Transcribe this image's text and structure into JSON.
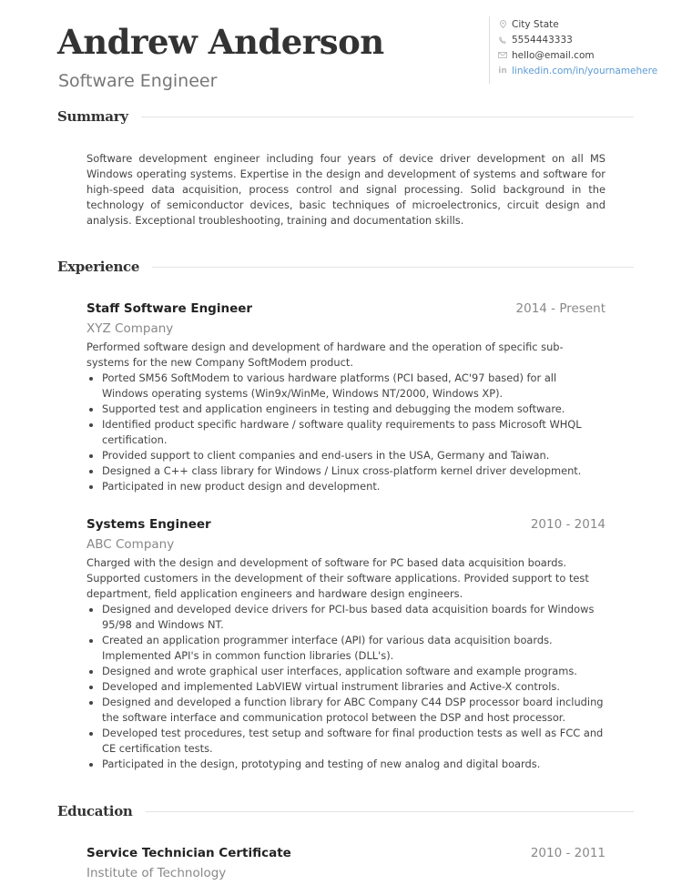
{
  "header": {
    "name": "Andrew Anderson",
    "title": "Software Engineer"
  },
  "contact": {
    "location": {
      "icon": "location-pin-icon",
      "value": "City State"
    },
    "phone": {
      "icon": "phone-icon",
      "value": "5554443333"
    },
    "email": {
      "icon": "envelope-icon",
      "value": "hello@email.com"
    },
    "linkedin": {
      "icon": "linkedin-icon",
      "value": "linkedin.com/in/yournamehere"
    },
    "link_color": "#5b9bd5"
  },
  "sections": {
    "summary": "Summary",
    "experience": "Experience",
    "education": "Education"
  },
  "summary": "Software development engineer including four years of device driver development on all MS Windows operating systems.  Expertise in the design and development of systems and software for high-speed data acquisition, process control and signal processing.  Solid background in the technology of semiconductor devices, basic techniques of microelectronics, circuit design and analysis.  Exceptional troubleshooting, training and documentation skills.",
  "experience": [
    {
      "title": "Staff Software Engineer",
      "dates": "2014 - Present",
      "company": "XYZ Company",
      "description": "Performed software design and development of hardware and the operation of specific sub-systems for the new Company SoftModem product.",
      "bullets": [
        "Ported SM56 SoftModem to various hardware platforms (PCI based, AC'97 based) for all Windows operating systems (Win9x/WinMe, Windows NT/2000, Windows XP).",
        "Supported test and application engineers in testing and debugging the modem software.",
        "Identified product specific hardware / software quality requirements to pass Microsoft WHQL certification.",
        "Provided support to client companies and end-users in the USA, Germany and Taiwan.",
        "Designed a C++ class library for Windows / Linux cross-platform kernel driver development.",
        "Participated in new product design and development."
      ]
    },
    {
      "title": "Systems Engineer",
      "dates": "2010 - 2014",
      "company": "ABC Company",
      "description": "Charged with the design and development of software for PC based data acquisition boards. Supported customers in the development of their software applications. Provided support to test department, field application engineers and hardware design engineers.",
      "bullets": [
        "Designed and developed device drivers for PCI-bus based data acquisition boards for Windows 95/98 and Windows NT.",
        "Created an application programmer interface (API) for various data acquisition boards. Implemented API's in common function libraries (DLL's).",
        "Designed and wrote graphical user interfaces, application software and example programs.",
        "Developed and implemented LabVIEW virtual instrument libraries and Active-X controls.",
        "Designed and developed a function library for ABC Company C44 DSP processor board including the software interface and communication protocol between the DSP and host processor.",
        "Developed test procedures, test setup and software for final production tests as well as FCC and CE certification tests.",
        "Participated in the design, prototyping and testing of new analog and digital boards."
      ]
    }
  ],
  "education": [
    {
      "title": "Service Technician Certificate",
      "dates": "2010 - 2011",
      "institution": "Institute of Technology"
    }
  ]
}
